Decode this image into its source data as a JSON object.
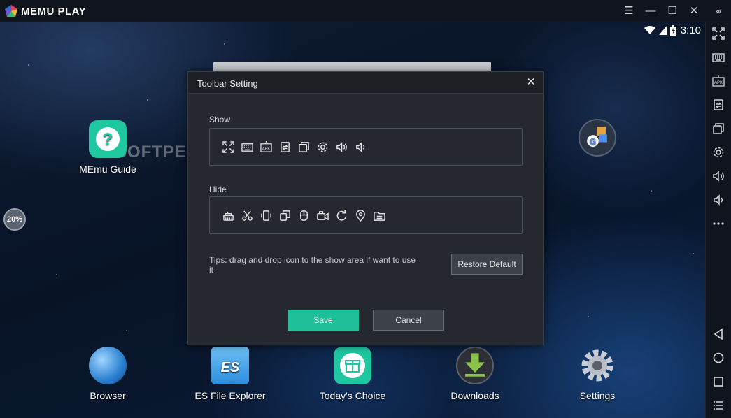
{
  "window": {
    "brand": "MEMU PLAY",
    "menu_icon": "hamburger-menu-icon",
    "minimize_icon": "minimize-icon",
    "maximize_icon": "maximize-icon",
    "close_icon": "close-icon",
    "collapse_icon": "collapse-toolbar-icon"
  },
  "status_bar": {
    "time": "3:10",
    "icons": [
      "wifi-icon",
      "signal-icon",
      "battery-icon"
    ]
  },
  "desktop": {
    "watermark": "SOFTPEDIA",
    "side_widget_label": "20%",
    "top_apps": [
      {
        "label": "MEmu Guide",
        "icon": "help-icon"
      },
      {
        "label": "",
        "icon": "google-folder-icon"
      }
    ],
    "dock": [
      {
        "label": "Browser",
        "icon": "globe-icon"
      },
      {
        "label": "ES File Explorer",
        "icon": "folder-icon"
      },
      {
        "label": "Today's Choice",
        "icon": "gift-icon"
      },
      {
        "label": "Downloads",
        "icon": "download-icon"
      },
      {
        "label": "Settings",
        "icon": "gear-icon"
      }
    ]
  },
  "toolbar": {
    "buttons": [
      "fullscreen-icon",
      "keyboard-icon",
      "apk-icon",
      "rotate-screen-icon",
      "multi-window-icon",
      "settings-icon",
      "volume-up-icon",
      "volume-down-icon",
      "more-icon",
      "back-icon",
      "home-icon",
      "recent-apps-icon",
      "menu-list-icon"
    ]
  },
  "dialog": {
    "title": "Toolbar Setting",
    "show_label": "Show",
    "show_icons": [
      "fullscreen-icon",
      "keyboard-icon",
      "apk-icon",
      "rotate-screen-icon",
      "multi-window-icon",
      "settings-icon",
      "volume-up-icon",
      "volume-down-icon"
    ],
    "hide_label": "Hide",
    "hide_icons": [
      "memory-clean-icon",
      "screenshot-cut-icon",
      "shake-icon",
      "copy-icon",
      "mouse-icon",
      "video-record-icon",
      "refresh-icon",
      "location-icon",
      "shared-folder-icon"
    ],
    "tips": "Tips: drag and drop icon to the show area if want to use it",
    "restore_label": "Restore Default",
    "save_label": "Save",
    "cancel_label": "Cancel"
  },
  "colors": {
    "accent": "#1fbf99",
    "titlebar": "#10151d",
    "dialog_bg": "#25292f"
  }
}
